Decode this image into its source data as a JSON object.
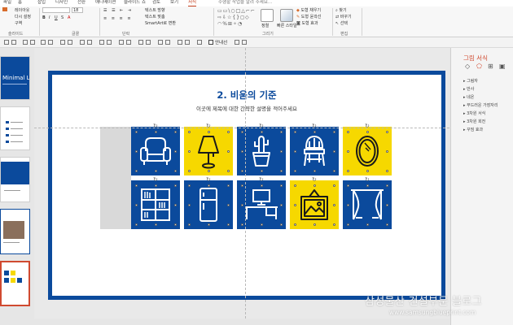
{
  "tabs": [
    "파일",
    "홈",
    "삽입",
    "디자인",
    "전환",
    "애니메이션",
    "슬라이드 쇼",
    "검토",
    "보기",
    "서식"
  ],
  "tell_me": "수행할 작업을 알려 주세요...",
  "ribbon": {
    "layout_label": "레이아웃",
    "reset_label": "다시 설정",
    "section_label": "구역",
    "slides_group": "슬라이드",
    "font_size": "18",
    "font_group": "글꼴",
    "paragraph_group": "단락",
    "text_direction": "텍스트 방향",
    "text_align": "텍스트 맞춤",
    "smartart": "SmartArt로 변환",
    "drawing_group": "그리기",
    "arrange_label": "정렬",
    "quick_styles_label": "빠른 스타일",
    "shape_fill": "도형 채우기",
    "shape_outline": "도형 윤곽선",
    "shape_effects": "도형 효과",
    "find": "찾기",
    "replace": "바꾸기",
    "select": "선택",
    "editing_group": "편집"
  },
  "toolbar2": {
    "guides_label": "안내선"
  },
  "slide": {
    "title": "2. 비움의 기준",
    "subtitle": "이곳에 제목에 대한 간략한 설명을 적어주세요"
  },
  "thumb1": {
    "title": "Minimal Life"
  },
  "tiles": [
    {
      "icon": "armchair-icon",
      "bg": "#0b4a9c",
      "fg": "#ffffff"
    },
    {
      "icon": "lamp-icon",
      "bg": "#f6d800",
      "fg": "#1a1a1a"
    },
    {
      "icon": "plant-icon",
      "bg": "#0b4a9c",
      "fg": "#ffffff"
    },
    {
      "icon": "chair-icon",
      "bg": "#0b4a9c",
      "fg": "#ffffff"
    },
    {
      "icon": "mirror-icon",
      "bg": "#f6d800",
      "fg": "#1a1a1a"
    },
    {
      "icon": "bookshelf-icon",
      "bg": "#0b4a9c",
      "fg": "#ffffff"
    },
    {
      "icon": "refrigerator-icon",
      "bg": "#0b4a9c",
      "fg": "#ffffff"
    },
    {
      "icon": "desk-icon",
      "bg": "#0b4a9c",
      "fg": "#ffffff"
    },
    {
      "icon": "picture-frame-icon",
      "bg": "#f6d800",
      "fg": "#1a1a1a"
    },
    {
      "icon": "curtain-icon",
      "bg": "#0b4a9c",
      "fg": "#ffffff"
    }
  ],
  "pane": {
    "title": "그림 서식",
    "items": [
      "그림자",
      "반사",
      "네온",
      "부드러운 가장자리",
      "3차원 서식",
      "3차원 회전",
      "꾸밈 효과"
    ]
  },
  "watermark": {
    "line1": "삼성물산 건설부문 블로그",
    "line2": "www.samsungblueprint.com"
  },
  "colors": {
    "accent_blue": "#0b4a9c",
    "accent_yellow": "#f6d800",
    "ribbon_accent": "#c43e1c"
  }
}
